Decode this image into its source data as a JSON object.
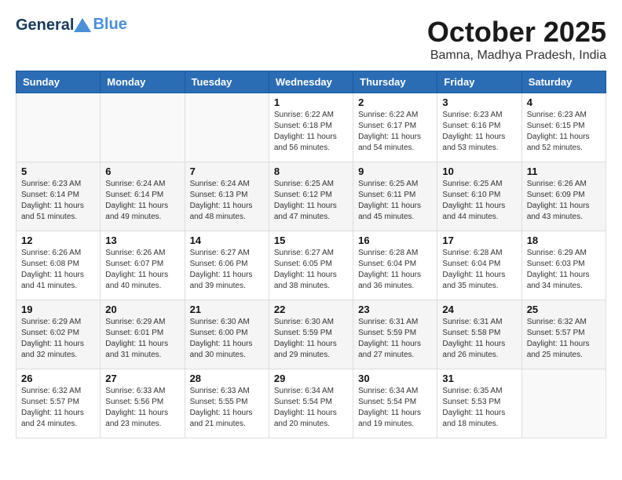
{
  "header": {
    "logo_line1": "General",
    "logo_line2": "Blue",
    "month": "October 2025",
    "location": "Bamna, Madhya Pradesh, India"
  },
  "weekdays": [
    "Sunday",
    "Monday",
    "Tuesday",
    "Wednesday",
    "Thursday",
    "Friday",
    "Saturday"
  ],
  "weeks": [
    [
      {
        "day": "",
        "info": ""
      },
      {
        "day": "",
        "info": ""
      },
      {
        "day": "",
        "info": ""
      },
      {
        "day": "1",
        "info": "Sunrise: 6:22 AM\nSunset: 6:18 PM\nDaylight: 11 hours\nand 56 minutes."
      },
      {
        "day": "2",
        "info": "Sunrise: 6:22 AM\nSunset: 6:17 PM\nDaylight: 11 hours\nand 54 minutes."
      },
      {
        "day": "3",
        "info": "Sunrise: 6:23 AM\nSunset: 6:16 PM\nDaylight: 11 hours\nand 53 minutes."
      },
      {
        "day": "4",
        "info": "Sunrise: 6:23 AM\nSunset: 6:15 PM\nDaylight: 11 hours\nand 52 minutes."
      }
    ],
    [
      {
        "day": "5",
        "info": "Sunrise: 6:23 AM\nSunset: 6:14 PM\nDaylight: 11 hours\nand 51 minutes."
      },
      {
        "day": "6",
        "info": "Sunrise: 6:24 AM\nSunset: 6:14 PM\nDaylight: 11 hours\nand 49 minutes."
      },
      {
        "day": "7",
        "info": "Sunrise: 6:24 AM\nSunset: 6:13 PM\nDaylight: 11 hours\nand 48 minutes."
      },
      {
        "day": "8",
        "info": "Sunrise: 6:25 AM\nSunset: 6:12 PM\nDaylight: 11 hours\nand 47 minutes."
      },
      {
        "day": "9",
        "info": "Sunrise: 6:25 AM\nSunset: 6:11 PM\nDaylight: 11 hours\nand 45 minutes."
      },
      {
        "day": "10",
        "info": "Sunrise: 6:25 AM\nSunset: 6:10 PM\nDaylight: 11 hours\nand 44 minutes."
      },
      {
        "day": "11",
        "info": "Sunrise: 6:26 AM\nSunset: 6:09 PM\nDaylight: 11 hours\nand 43 minutes."
      }
    ],
    [
      {
        "day": "12",
        "info": "Sunrise: 6:26 AM\nSunset: 6:08 PM\nDaylight: 11 hours\nand 41 minutes."
      },
      {
        "day": "13",
        "info": "Sunrise: 6:26 AM\nSunset: 6:07 PM\nDaylight: 11 hours\nand 40 minutes."
      },
      {
        "day": "14",
        "info": "Sunrise: 6:27 AM\nSunset: 6:06 PM\nDaylight: 11 hours\nand 39 minutes."
      },
      {
        "day": "15",
        "info": "Sunrise: 6:27 AM\nSunset: 6:05 PM\nDaylight: 11 hours\nand 38 minutes."
      },
      {
        "day": "16",
        "info": "Sunrise: 6:28 AM\nSunset: 6:04 PM\nDaylight: 11 hours\nand 36 minutes."
      },
      {
        "day": "17",
        "info": "Sunrise: 6:28 AM\nSunset: 6:04 PM\nDaylight: 11 hours\nand 35 minutes."
      },
      {
        "day": "18",
        "info": "Sunrise: 6:29 AM\nSunset: 6:03 PM\nDaylight: 11 hours\nand 34 minutes."
      }
    ],
    [
      {
        "day": "19",
        "info": "Sunrise: 6:29 AM\nSunset: 6:02 PM\nDaylight: 11 hours\nand 32 minutes."
      },
      {
        "day": "20",
        "info": "Sunrise: 6:29 AM\nSunset: 6:01 PM\nDaylight: 11 hours\nand 31 minutes."
      },
      {
        "day": "21",
        "info": "Sunrise: 6:30 AM\nSunset: 6:00 PM\nDaylight: 11 hours\nand 30 minutes."
      },
      {
        "day": "22",
        "info": "Sunrise: 6:30 AM\nSunset: 5:59 PM\nDaylight: 11 hours\nand 29 minutes."
      },
      {
        "day": "23",
        "info": "Sunrise: 6:31 AM\nSunset: 5:59 PM\nDaylight: 11 hours\nand 27 minutes."
      },
      {
        "day": "24",
        "info": "Sunrise: 6:31 AM\nSunset: 5:58 PM\nDaylight: 11 hours\nand 26 minutes."
      },
      {
        "day": "25",
        "info": "Sunrise: 6:32 AM\nSunset: 5:57 PM\nDaylight: 11 hours\nand 25 minutes."
      }
    ],
    [
      {
        "day": "26",
        "info": "Sunrise: 6:32 AM\nSunset: 5:57 PM\nDaylight: 11 hours\nand 24 minutes."
      },
      {
        "day": "27",
        "info": "Sunrise: 6:33 AM\nSunset: 5:56 PM\nDaylight: 11 hours\nand 23 minutes."
      },
      {
        "day": "28",
        "info": "Sunrise: 6:33 AM\nSunset: 5:55 PM\nDaylight: 11 hours\nand 21 minutes."
      },
      {
        "day": "29",
        "info": "Sunrise: 6:34 AM\nSunset: 5:54 PM\nDaylight: 11 hours\nand 20 minutes."
      },
      {
        "day": "30",
        "info": "Sunrise: 6:34 AM\nSunset: 5:54 PM\nDaylight: 11 hours\nand 19 minutes."
      },
      {
        "day": "31",
        "info": "Sunrise: 6:35 AM\nSunset: 5:53 PM\nDaylight: 11 hours\nand 18 minutes."
      },
      {
        "day": "",
        "info": ""
      }
    ]
  ]
}
